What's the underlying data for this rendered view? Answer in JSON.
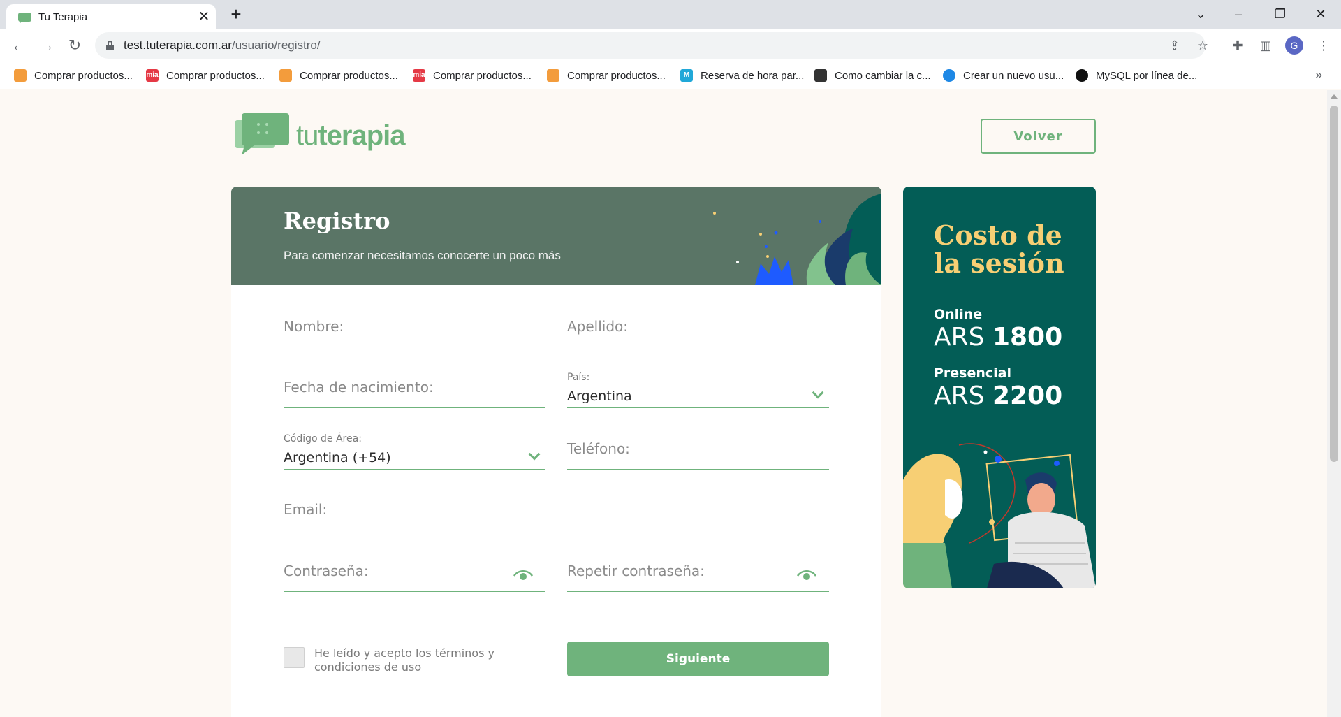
{
  "browser": {
    "tab_title": "Tu Terapia",
    "tab_close": "✕",
    "new_tab": "+",
    "url_host": "test.tuterapia.com.ar",
    "url_path": "/usuario/registro/",
    "profile_initial": "G",
    "bookmarks": [
      "Comprar productos...",
      "Comprar productos...",
      "Comprar productos...",
      "Comprar productos...",
      "Comprar productos...",
      "Reserva de hora par...",
      "Como cambiar la c...",
      "Crear un nuevo usu...",
      "MySQL por línea de..."
    ],
    "bookmarks_more": "»"
  },
  "header": {
    "logo_tu": "tu",
    "logo_terapia": "terapia",
    "back_label": "Volver"
  },
  "form": {
    "title": "Registro",
    "subtitle": "Para comenzar necesitamos conocerte un poco más",
    "nombre_placeholder": "Nombre:",
    "apellido_placeholder": "Apellido:",
    "fecha_placeholder": "Fecha de nacimiento:",
    "pais_label": "País:",
    "pais_value": "Argentina",
    "codigo_label": "Código de Área:",
    "codigo_value": "Argentina (+54)",
    "telefono_placeholder": "Teléfono:",
    "email_placeholder": "Email:",
    "password_placeholder": "Contraseña:",
    "password_repeat_placeholder": "Repetir contraseña:",
    "terms_text": "He leído y acepto los términos y condiciones de uso",
    "submit_label": "Siguiente"
  },
  "pricing": {
    "title": "Costo de la sesión",
    "online_label": "Online",
    "online_currency": "ARS",
    "online_price": "1800",
    "presencial_label": "Presencial",
    "presencial_currency": "ARS",
    "presencial_price": "2200"
  },
  "colors": {
    "accent": "#6fb37c",
    "header_bg": "#5a7566",
    "aside_bg": "#035d56",
    "aside_title": "#f7cf74",
    "page_bg": "#fdf9f4"
  }
}
